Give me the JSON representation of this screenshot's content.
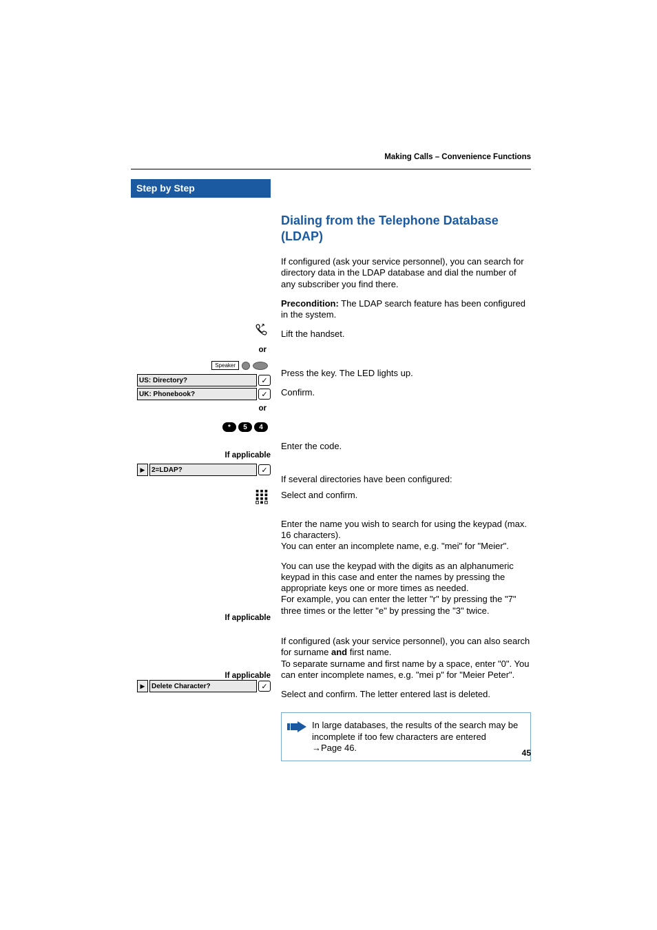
{
  "runningHead": "Making Calls – Convenience Functions",
  "stepByStep": "Step by Step",
  "sectionTitle": "Dialing from the Telephone Database (LDAP)",
  "intro": "If configured (ask your service personnel), you can search for directory data in the LDAP database and dial the number of any subscriber you find there.",
  "preconditionLabel": "Precondition:",
  "preconditionText": " The LDAP search feature has been configured in the system.",
  "liftHandset": "Lift the handset.",
  "or": "or",
  "speakerLabel": "Speaker",
  "pressKey": "Press the key. The LED lights up.",
  "menuUS": "US: Directory?",
  "menuUK": "UK: Phonebook?",
  "confirm": "Confirm.",
  "codeKeys": {
    "k1": "*",
    "k2": "5",
    "k3": "4"
  },
  "enterCode": "Enter the code.",
  "ifApplicable": "If applicable",
  "ifDirs": "If several directories have been configured:",
  "menuLDAP": "2=LDAP?",
  "selectConfirm": "Select and confirm.",
  "enterName": "Enter the name you wish to search for using the keypad (max. 16 characters).\nYou can enter an incomplete name, e.g. \"mei\" for \"Meier\".",
  "keypadPara": "You can use the keypad with the digits as an alphanumeric keypad in this case and enter the names by pressing the appropriate keys one or more times as needed.\nFor example, you can enter the letter \"r\" by pressing the \"7\" three times or the letter \"e\" by pressing the \"3\" twice.",
  "surnameParaPre": "If configured (ask your service personnel), you can also search for surname ",
  "surnameAnd": "and",
  "surnameParaPost": " first name.\nTo separate surname and first name by a space, enter \"0\". You can enter incomplete names, e.g. \"mei p\" for \"Meier Peter\".",
  "menuDelChar": "Delete Character?",
  "selectConfirmDel": "Select and confirm. The letter entered last is deleted.",
  "noteText": "In large databases, the results of the search may be incomplete if too few characters are entered ",
  "notePageRef": "Page 46.",
  "pageNumber": "45"
}
